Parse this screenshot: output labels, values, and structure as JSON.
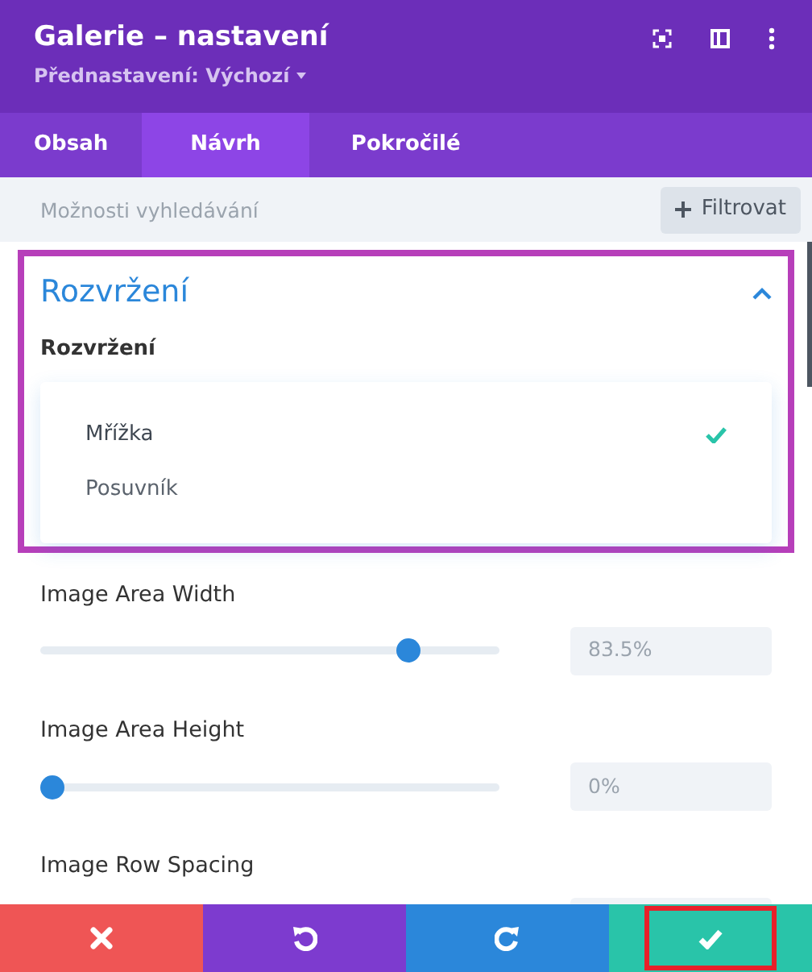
{
  "header": {
    "title": "Galerie – nastavení",
    "preset": "Přednastavení: Výchozí"
  },
  "tabs": [
    {
      "label": "Obsah",
      "selected": false
    },
    {
      "label": "Návrh",
      "selected": true
    },
    {
      "label": "Pokročilé",
      "selected": false
    }
  ],
  "search": {
    "placeholder": "Možnosti vyhledávání"
  },
  "filter_button": {
    "label": "Filtrovat"
  },
  "section": {
    "title": "Rozvržení",
    "expanded": true,
    "highlighted": true,
    "field_label": "Rozvržení",
    "options": [
      {
        "label": "Mřížka",
        "selected": true
      },
      {
        "label": "Posuvník",
        "selected": false
      }
    ]
  },
  "sliders": [
    {
      "label": "Image Area Width",
      "level": 0.82,
      "value": "83.5%"
    },
    {
      "label": "Image Area Height",
      "level": 0,
      "value": "0%"
    },
    {
      "label": "Image Row Spacing"
    }
  ],
  "footer": [
    {
      "kind": "cancel",
      "highlighted": false
    },
    {
      "kind": "undo",
      "highlighted": false
    },
    {
      "kind": "redo",
      "highlighted": false
    },
    {
      "kind": "save",
      "highlighted": true
    }
  ]
}
